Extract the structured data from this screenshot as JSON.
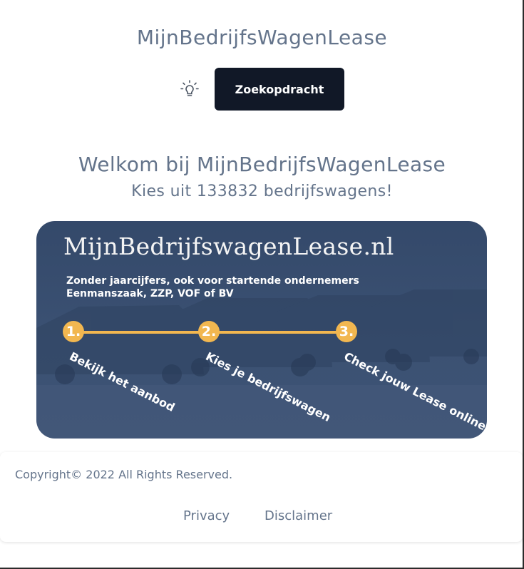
{
  "header": {
    "site_title": "MijnBedrijfsWagenLease",
    "search_button_label": "Zoekopdracht",
    "theme_icon": "lightbulb-icon"
  },
  "main": {
    "welcome_heading": "Welkom bij MijnBedrijfsWagenLease",
    "subtitle": "Kies uit 133832 bedrijfswagens!"
  },
  "banner": {
    "title": "MijnBedrijfswagenLease.nl",
    "line1": "Zonder jaarcijfers, ook voor startende ondernemers",
    "line2": "Eenmanszaak, ZZP, VOF of BV",
    "steps": [
      {
        "number": "1.",
        "label": "Bekijk het aanbod"
      },
      {
        "number": "2.",
        "label": "Kies je bedrijfswagen"
      },
      {
        "number": "3.",
        "label": "Check jouw Lease online"
      }
    ],
    "colors": {
      "background": "#3b5173",
      "accent": "#f2b750"
    }
  },
  "footer": {
    "copyright": "Copyright© 2022 All Rights Reserved.",
    "links": {
      "privacy": "Privacy",
      "disclaimer": "Disclaimer"
    }
  },
  "colors": {
    "text": "#64748b",
    "button_bg": "#111827"
  }
}
